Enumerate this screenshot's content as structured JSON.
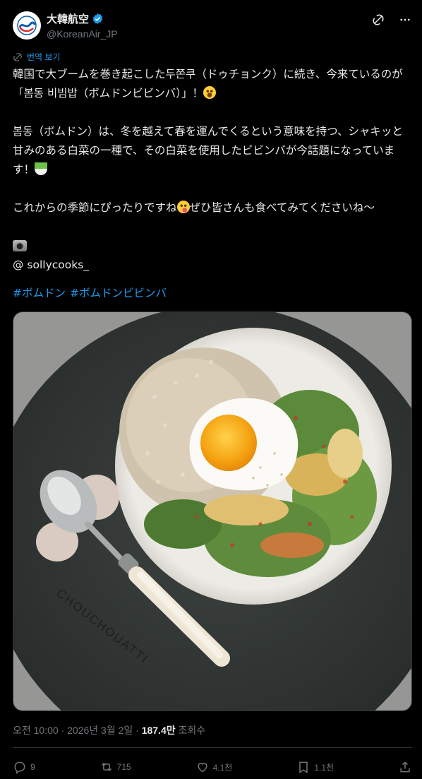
{
  "author": {
    "display_name": "大韓航空",
    "handle": "@KoreanAir_JP",
    "verified_icon": "verified-badge-icon",
    "brand_color": "#1d9bf0"
  },
  "translate_label": "번역 보기",
  "tweet": {
    "line1": "韓国で大ブームを巻き起こした두쫀쿠（ドゥチョンク）に続き、今来ているのが「봄동 비빔밥（ボムドンビビンバ）」！",
    "line2": "봄동（ボムドン）は、冬を越えて春を運んでくるという意味を持つ、シャキッと甘みのある白菜の一種で、その白菜を使用したビビンバが今話題になっています！",
    "line3a": "これからの季節にぴったりですね",
    "line3b": "ぜひ皆さんも食べてみてくださいね〜",
    "credit": "@ sollycooks_",
    "hashtags": [
      "#ボムドン",
      "#ボムドンビビンバ"
    ]
  },
  "image": {
    "brand_text": "CHOUCHOUATTI"
  },
  "meta": {
    "time": "오전 10:00 · 2026년 3월 2일 · ",
    "views": "187.4만",
    "views_label": " 조회수"
  },
  "actions": {
    "replies": "9",
    "reposts": "715",
    "likes": "4.1천",
    "bookmarks": "1.1천"
  }
}
